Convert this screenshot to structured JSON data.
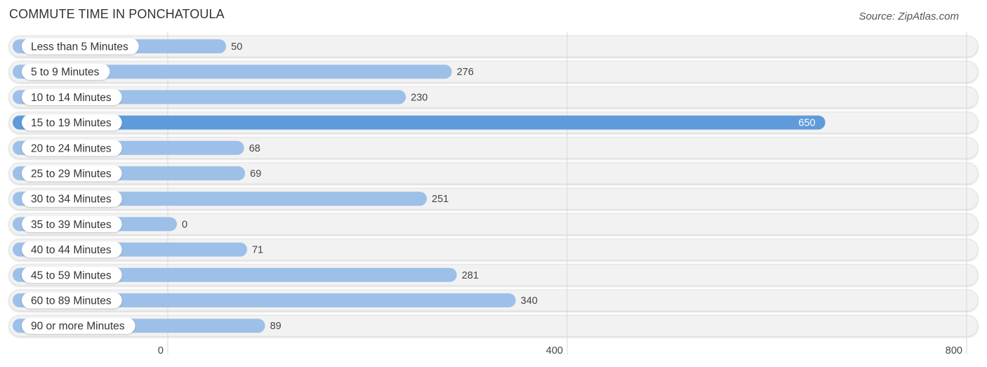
{
  "header": {
    "title": "COMMUTE TIME IN PONCHATOULA",
    "source": "Source: ZipAtlas.com"
  },
  "colors": {
    "bar": "#9dc0e8",
    "bar_highlight": "#5f9bdb",
    "track": "#f2f2f2",
    "grid": "#d8d8d8"
  },
  "chart_data": {
    "type": "bar",
    "orientation": "horizontal",
    "title": "COMMUTE TIME IN PONCHATOULA",
    "xlabel": "",
    "ylabel": "",
    "categories": [
      "Less than 5 Minutes",
      "5 to 9 Minutes",
      "10 to 14 Minutes",
      "15 to 19 Minutes",
      "20 to 24 Minutes",
      "25 to 29 Minutes",
      "30 to 34 Minutes",
      "35 to 39 Minutes",
      "40 to 44 Minutes",
      "45 to 59 Minutes",
      "60 to 89 Minutes",
      "90 or more Minutes"
    ],
    "values": [
      50,
      276,
      230,
      650,
      68,
      69,
      251,
      0,
      71,
      281,
      340,
      89
    ],
    "value_labels": [
      "50",
      "276",
      "230",
      "650",
      "68",
      "69",
      "251",
      "0",
      "71",
      "281",
      "340",
      "89"
    ],
    "highlight_index": 3,
    "xlim": [
      0,
      800
    ],
    "xticks": [
      0,
      400,
      800
    ],
    "xtick_labels": [
      "0",
      "400",
      "800"
    ],
    "grid": true,
    "legend": "none"
  }
}
